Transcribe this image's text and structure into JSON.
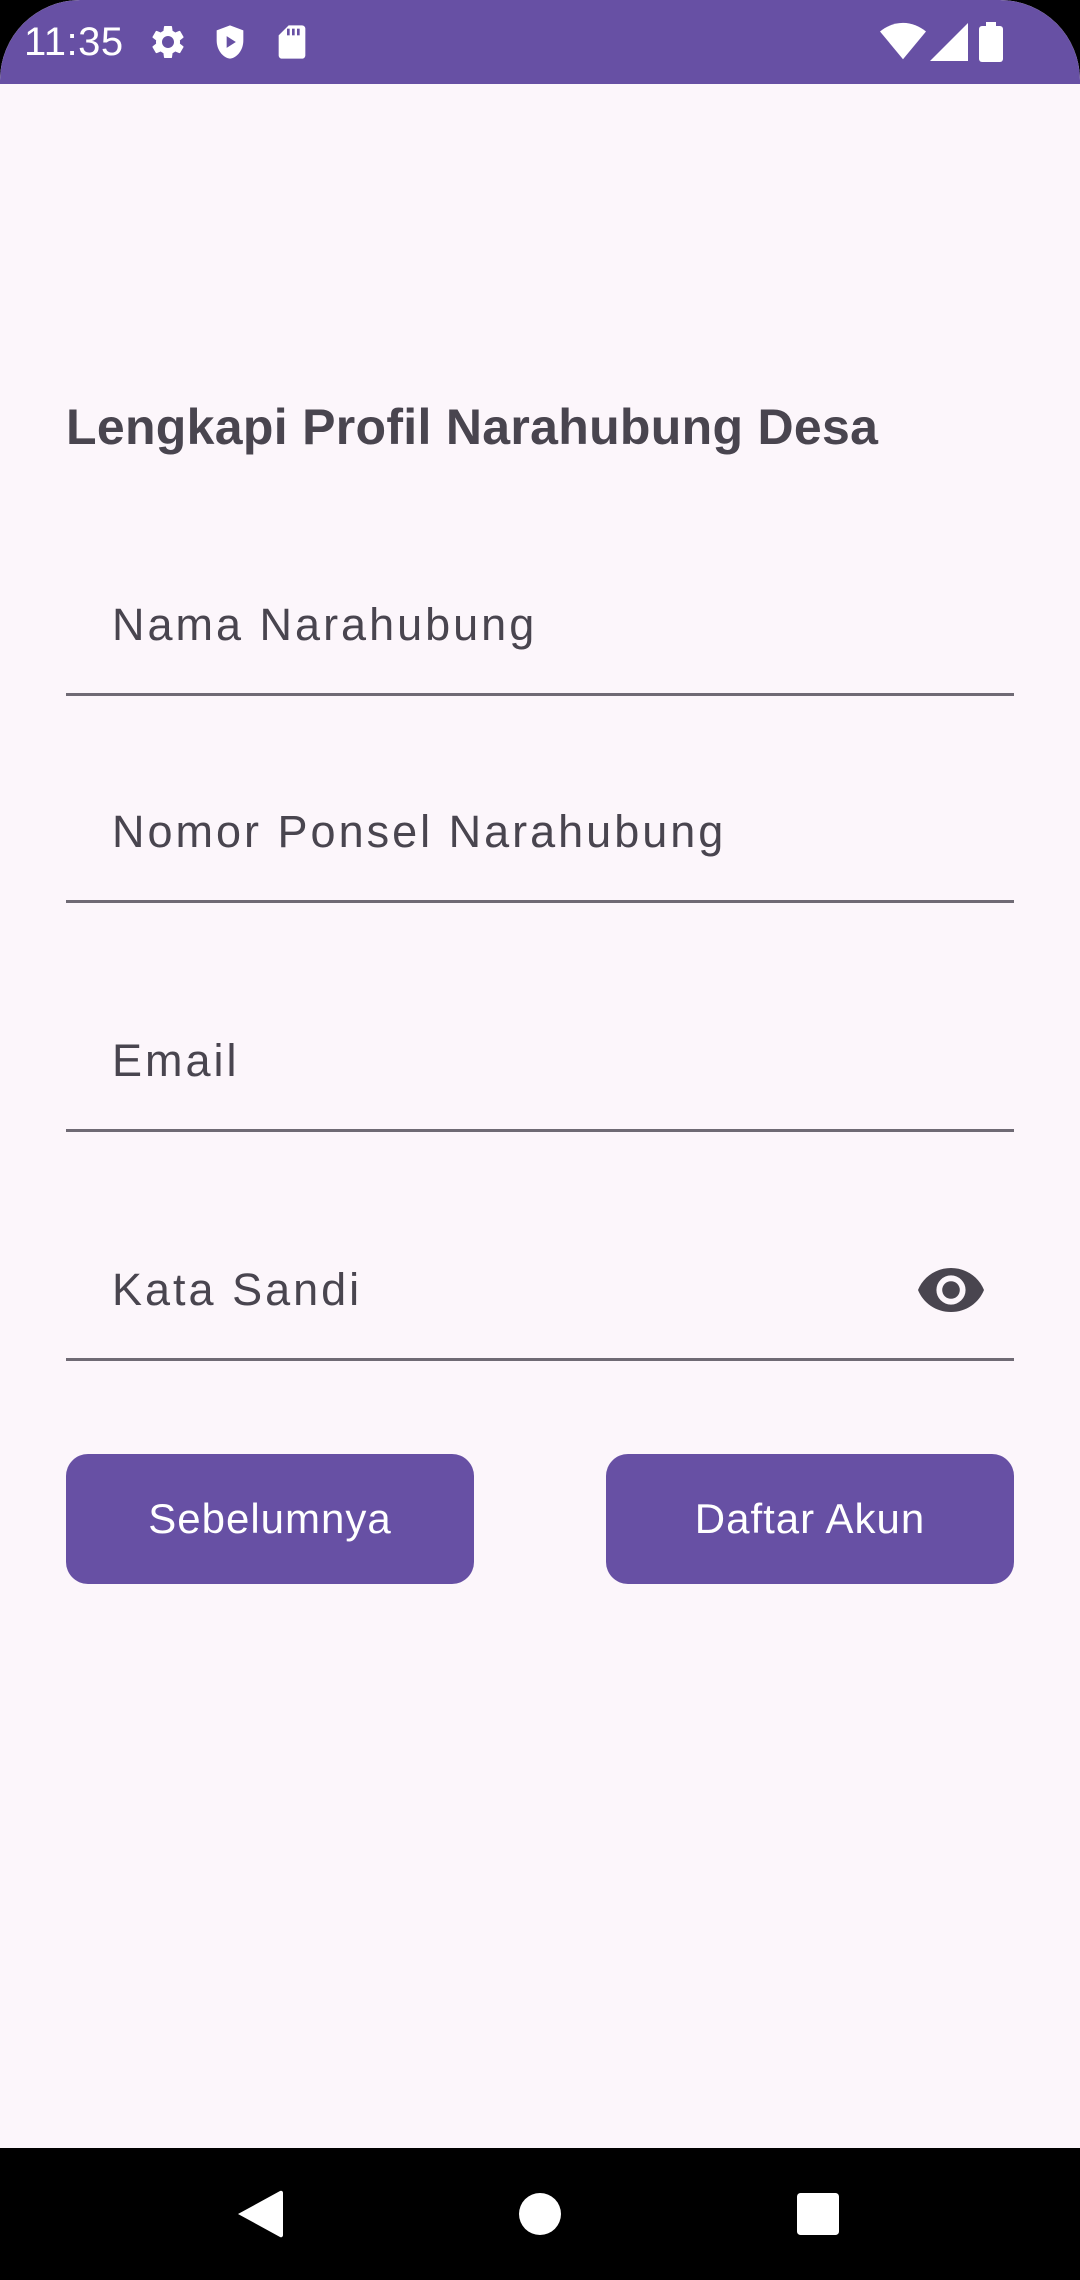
{
  "status_bar": {
    "time": "11:35",
    "left_icons": [
      "settings-icon",
      "shield-play-icon",
      "sd-card-icon"
    ],
    "right_icons": [
      "wifi-icon",
      "signal-icon",
      "battery-icon"
    ]
  },
  "page": {
    "title": "Lengkapi Profil Narahubung Desa"
  },
  "form": {
    "contact_name_label": "Nama Narahubung",
    "contact_phone_label": "Nomor Ponsel Narahubung",
    "email_label": "Email",
    "password_label": "Kata Sandi",
    "password_toggle_icon": "eye-icon"
  },
  "actions": {
    "previous_label": "Sebelumnya",
    "register_label": "Daftar Akun"
  },
  "navigation": {
    "buttons": [
      "back-icon",
      "home-icon",
      "recents-icon"
    ]
  },
  "colors": {
    "primary": "#6750A4",
    "background": "#FCF6FB",
    "text": "#49454F"
  }
}
